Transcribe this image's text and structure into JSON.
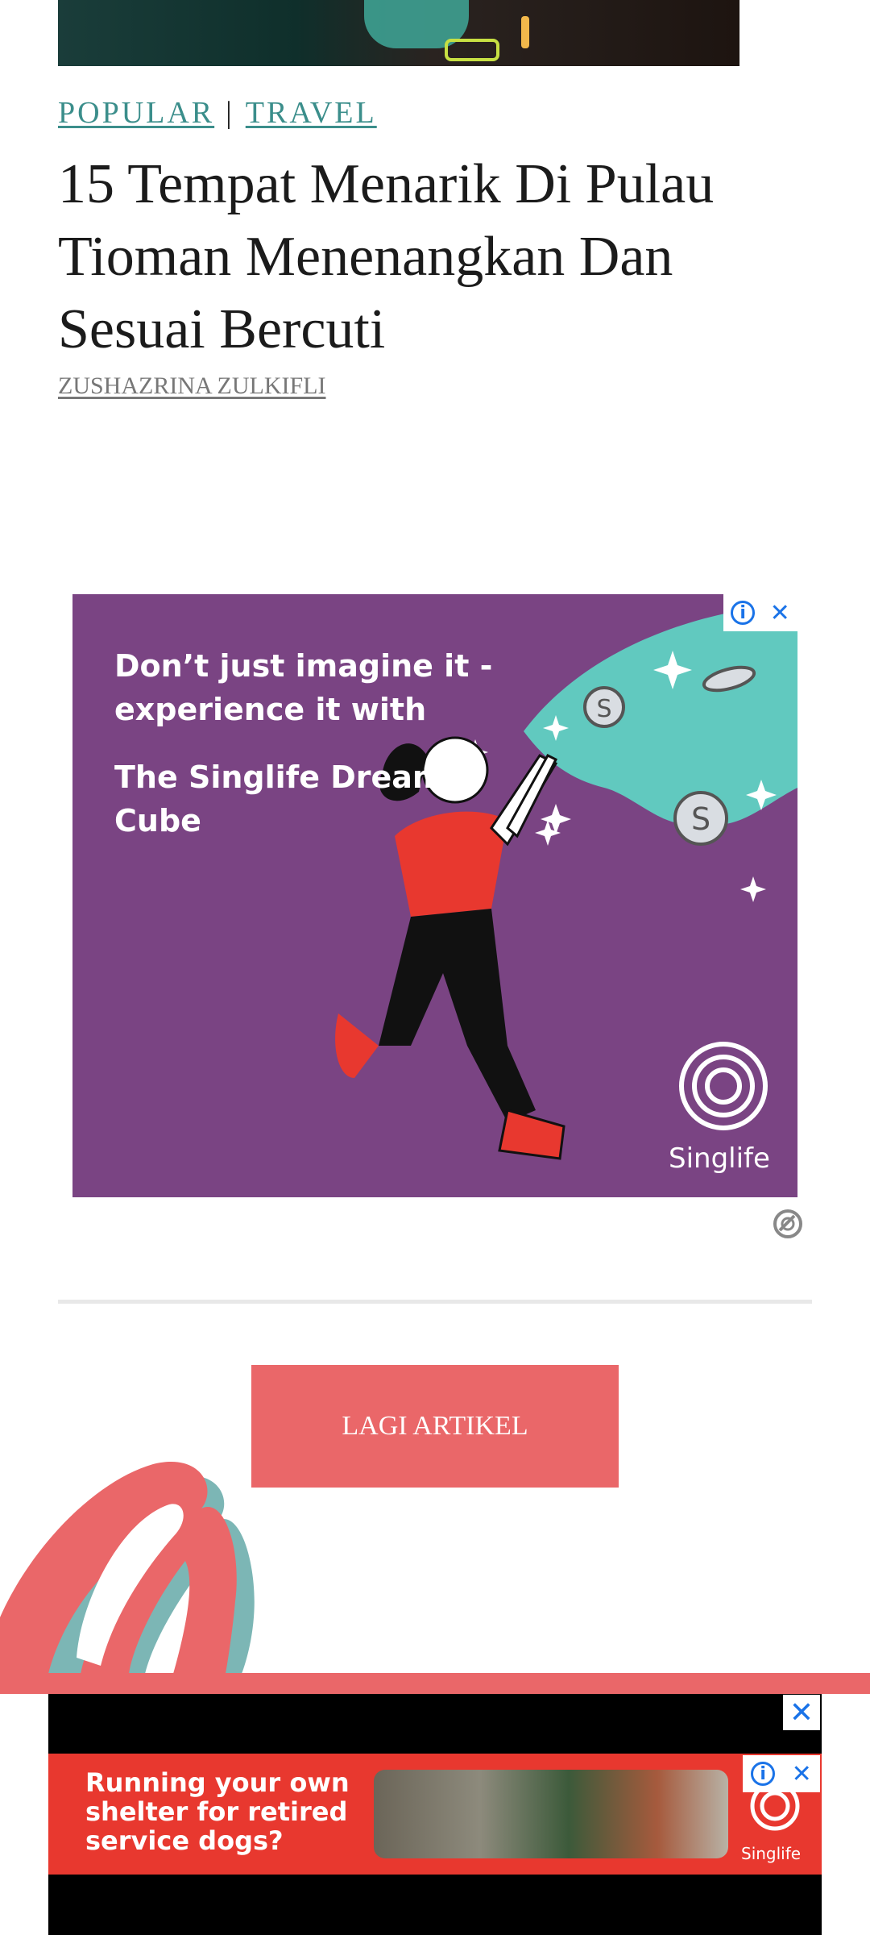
{
  "article": {
    "categories": [
      "POPULAR",
      "TRAVEL"
    ],
    "separator": "|",
    "title": "15 Tempat Menarik Di Pulau Tioman Menenangkan Dan Sesuai Bercuti",
    "author": "ZUSHAZRINA ZULKIFLI"
  },
  "ad": {
    "line1": "Don’t just imagine it - experience it with",
    "line2": "The Singlife Dream Cube",
    "brand": "Singlife",
    "info_icon": "i",
    "close_icon": "✕"
  },
  "more_button": {
    "label": "LAGI ARTIKEL"
  },
  "bottom_ad": {
    "close_icon": "✕",
    "banner_text": "Running your own shelter for retired service dogs?",
    "brand": "Singlife",
    "info_icon": "i"
  },
  "colors": {
    "accent": "#ea6769",
    "category": "#3b8e8b",
    "ad_background": "#7a4483",
    "banner_background": "#e8382f"
  }
}
